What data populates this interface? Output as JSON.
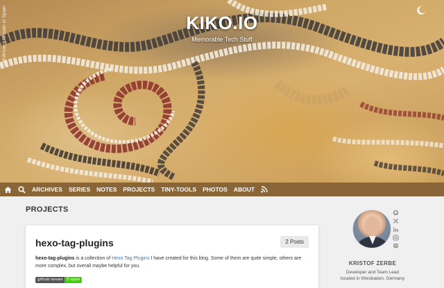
{
  "hero": {
    "caption": "Old Ancient Mosaic in Spain",
    "title": "KIKO.IO",
    "subtitle": "Memorable Tech Stuff",
    "theme_toggle_icon": "moon-icon"
  },
  "nav": {
    "home_icon": "home-icon",
    "search_icon": "search-icon",
    "items": [
      "ARCHIVES",
      "SERIES",
      "NOTES",
      "PROJECTS",
      "TINY-TOOLS",
      "PHOTOS",
      "ABOUT"
    ],
    "rss_icon": "rss-icon",
    "background": "#8a6636"
  },
  "main": {
    "heading": "PROJECTS",
    "project": {
      "title": "hexo-tag-plugins",
      "post_count": "2 Posts",
      "desc_name": "hexo-tag-plugins",
      "desc_pre": " is a collection of ",
      "desc_link": "Hexo Tag Plugins",
      "desc_post": " I have created for this blog. Some of them are quite simple, others are more complex, but overall maybe helpful for you.",
      "badge_label": "github issues",
      "badge_value": "0 open"
    }
  },
  "profile": {
    "name": "KRISTOF ZERBE",
    "role": "Developer and Team Lead",
    "location": "located in Wiesbaden, Germany",
    "social_icons": [
      "github-icon",
      "x-icon",
      "linkedin-icon",
      "instagram-icon",
      "mastodon-icon"
    ]
  }
}
